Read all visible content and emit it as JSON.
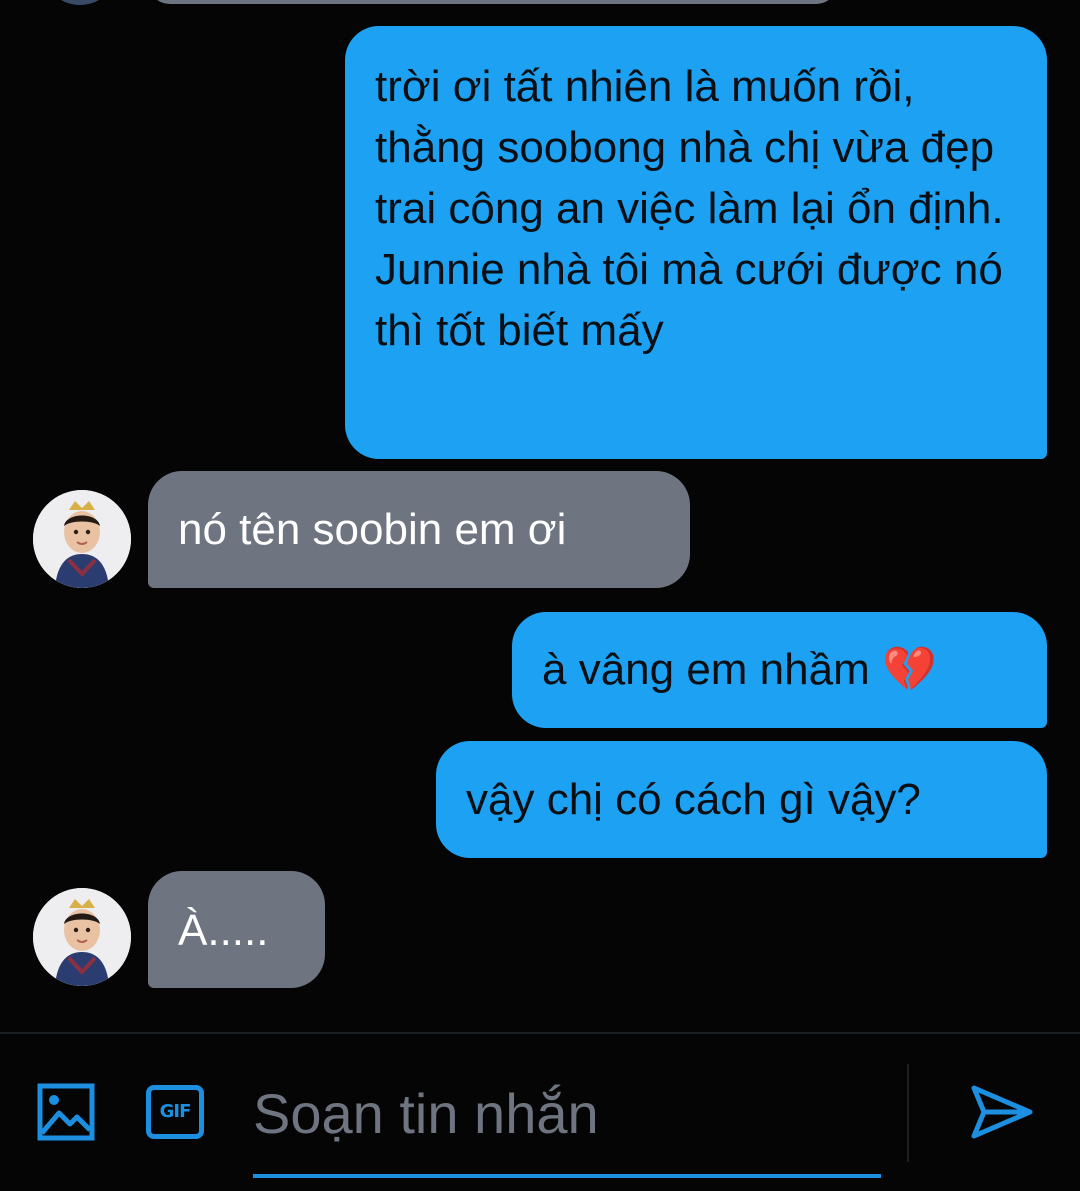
{
  "colors": {
    "background": "#050505",
    "sent_bubble": "#1da1f2",
    "received_bubble": "#6e7580",
    "accent": "#1d8fe0"
  },
  "messages": [
    {
      "direction": "sent",
      "text": "trời ơi tất nhiên là muốn rồi, thằng soobong nhà chị vừa đẹp trai công an việc làm lại ổn định. Junnie nhà tôi mà cưới được nó thì tốt biết mấy"
    },
    {
      "direction": "received",
      "text": "nó tên soobin em ơi"
    },
    {
      "direction": "sent",
      "text": "à vâng em nhầm 💔"
    },
    {
      "direction": "sent",
      "text": "vậy chị có cách gì vậy?"
    },
    {
      "direction": "received",
      "text": "À....."
    }
  ],
  "composer": {
    "placeholder": "Soạn tin nhắn",
    "gif_label": "GIF",
    "image_icon": "image-icon",
    "send_icon": "send-icon"
  }
}
